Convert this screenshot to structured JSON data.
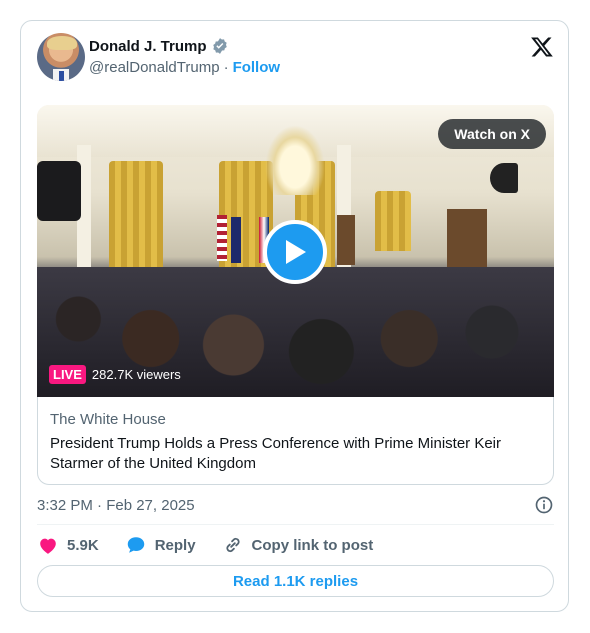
{
  "author": {
    "name": "Donald J. Trump",
    "handle": "@realDonaldTrump",
    "separator": "·",
    "follow_label": "Follow"
  },
  "media": {
    "watch_label": "Watch on X",
    "live_badge": "LIVE",
    "viewers": "282.7K viewers"
  },
  "link_card": {
    "source": "The White House",
    "headline": "President Trump Holds a Press Conference with Prime Minister Keir Starmer of the United Kingdom"
  },
  "timestamp": "3:32 PM · Feb 27, 2025",
  "actions": {
    "likes": "5.9K",
    "reply_label": "Reply",
    "copy_label": "Copy link to post",
    "read_replies_label": "Read 1.1K replies"
  },
  "colors": {
    "accent": "#1d9bf0",
    "like": "#f91880",
    "live": "#f91880",
    "muted": "#536471"
  },
  "icons": [
    "verified-badge-icon",
    "x-logo-icon",
    "play-icon",
    "info-icon",
    "heart-icon",
    "reply-bubble-icon",
    "link-icon"
  ]
}
